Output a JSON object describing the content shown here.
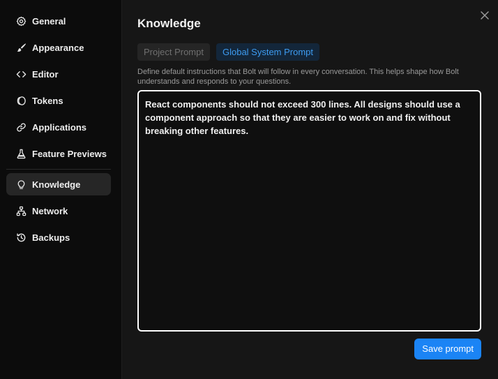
{
  "sidebar": {
    "items": [
      {
        "label": "General",
        "icon": "gear-icon"
      },
      {
        "label": "Appearance",
        "icon": "paintbrush-icon"
      },
      {
        "label": "Editor",
        "icon": "code-icon"
      },
      {
        "label": "Tokens",
        "icon": "coins-icon"
      },
      {
        "label": "Applications",
        "icon": "link-icon"
      },
      {
        "label": "Feature Previews",
        "icon": "flask-icon"
      },
      {
        "label": "Knowledge",
        "icon": "lightbulb-icon",
        "active": true
      },
      {
        "label": "Network",
        "icon": "network-icon"
      },
      {
        "label": "Backups",
        "icon": "history-icon"
      }
    ]
  },
  "main": {
    "title": "Knowledge",
    "tabs": [
      {
        "label": "Project Prompt",
        "active": false
      },
      {
        "label": "Global System Prompt",
        "active": true
      }
    ],
    "description": "Define default instructions that Bolt will follow in every conversation. This helps shape how Bolt understands and responds to your questions.",
    "prompt_text": "React components should not exceed 300 lines. All designs should use a component approach so that they are easier to work on and fix without breaking other features.",
    "save_label": "Save prompt"
  },
  "colors": {
    "accent": "#1b84f5",
    "active_tab_text": "#3d9bf0",
    "background": "#161616",
    "sidebar_background": "#0c0c0c"
  }
}
